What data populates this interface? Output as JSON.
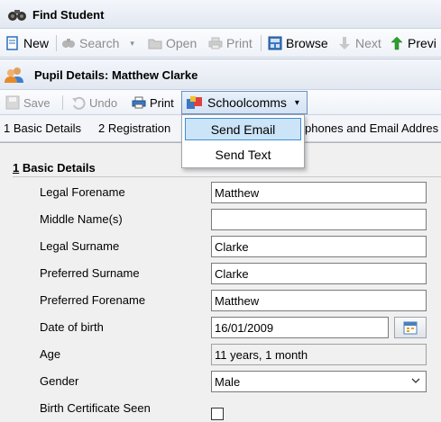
{
  "app": {
    "title": "Find Student"
  },
  "toolbar": {
    "new_label": "New",
    "search_label": "Search",
    "open_label": "Open",
    "print_label": "Print",
    "browse_label": "Browse",
    "next_label": "Next",
    "previous_label": "Previ"
  },
  "record": {
    "title": "Pupil Details: Matthew Clarke"
  },
  "record_toolbar": {
    "save_label": "Save",
    "undo_label": "Undo",
    "print_label": "Print",
    "schoolcomms_label": "Schoolcomms"
  },
  "schoolcomms_menu": {
    "items": [
      "Send Email",
      "Send Text"
    ]
  },
  "tabs": [
    "1 Basic Details",
    "2 Registration",
    "phones and Email Addres"
  ],
  "section": {
    "number": "1",
    "title": " Basic Details"
  },
  "form": {
    "legal_forename": {
      "label": "Legal Forename",
      "value": "Matthew"
    },
    "middle_names": {
      "label": "Middle Name(s)",
      "value": ""
    },
    "legal_surname": {
      "label": "Legal Surname",
      "value": "Clarke"
    },
    "preferred_surname": {
      "label": "Preferred Surname",
      "value": "Clarke"
    },
    "preferred_forename": {
      "label": "Preferred Forename",
      "value": "Matthew"
    },
    "date_of_birth": {
      "label": "Date of birth",
      "value": "16/01/2009"
    },
    "age": {
      "label": "Age",
      "value": "11 years, 1 month"
    },
    "gender": {
      "label": "Gender",
      "value": "Male"
    },
    "birth_certificate_seen": {
      "label": "Birth Certificate Seen",
      "checked": false
    }
  },
  "colors": {
    "accent": "#3d8fd9",
    "menu_highlight": "#cce4f7",
    "toolbar_bg": "#eef2f8"
  },
  "icons": [
    "binoculars-icon",
    "new-document-icon",
    "search-icon",
    "open-folder-icon",
    "printer-icon",
    "browse-icon",
    "next-arrow-icon",
    "previous-arrow-icon",
    "pupil-icon",
    "save-icon",
    "undo-icon",
    "schoolcomms-icon",
    "calendar-icon",
    "chevron-down-icon"
  ]
}
